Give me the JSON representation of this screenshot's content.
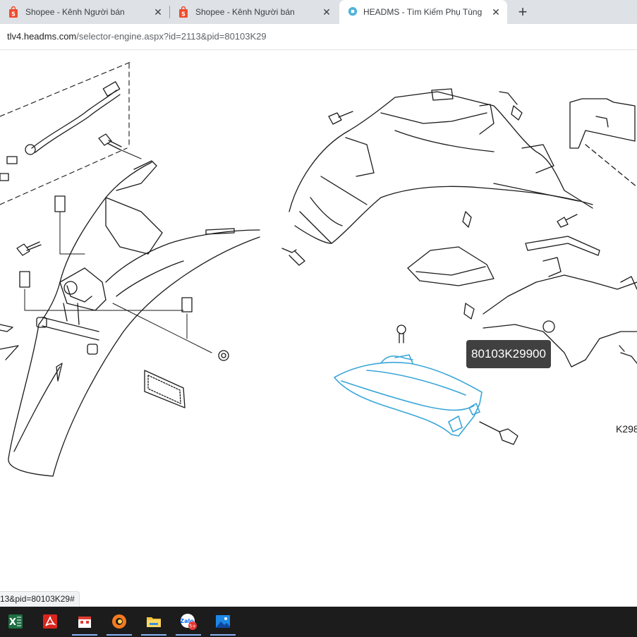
{
  "browser": {
    "tabs": [
      {
        "title": "Shopee - Kênh Người bán",
        "favicon": "shopee-bag-icon",
        "active": false
      },
      {
        "title": "Shopee - Kênh Người bán",
        "favicon": "shopee-bag-icon",
        "active": false
      },
      {
        "title": "HEADMS - Tìm Kiếm Phụ Tùng",
        "favicon": "headms-icon",
        "active": true
      }
    ],
    "close_glyph": "✕",
    "new_tab_glyph": "+",
    "url_host": "tlv4.headms.com",
    "url_path": "/selector-engine.aspx?id=2113&pid=80103K29"
  },
  "diagram": {
    "highlighted_part_tooltip": "80103K29900",
    "diagram_code": "K298",
    "highlight_color": "#3aa6d8"
  },
  "status_bar": {
    "link_preview": "13&pid=80103K29#"
  },
  "taskbar": {
    "apps": [
      {
        "name": "excel-icon",
        "open": false
      },
      {
        "name": "acrobat-icon",
        "open": false
      },
      {
        "name": "office-app-icon",
        "open": true
      },
      {
        "name": "coc-coc-browser-icon",
        "open": true
      },
      {
        "name": "file-explorer-icon",
        "open": true
      },
      {
        "name": "zalo-icon",
        "open": true,
        "badge": "5+"
      },
      {
        "name": "photos-icon",
        "open": true
      }
    ]
  },
  "colors": {
    "tab_strip": "#dee1e6",
    "shopee_orange": "#ee4d2d",
    "taskbar": "#1c1c1c",
    "tooltip_bg": "#404040"
  }
}
